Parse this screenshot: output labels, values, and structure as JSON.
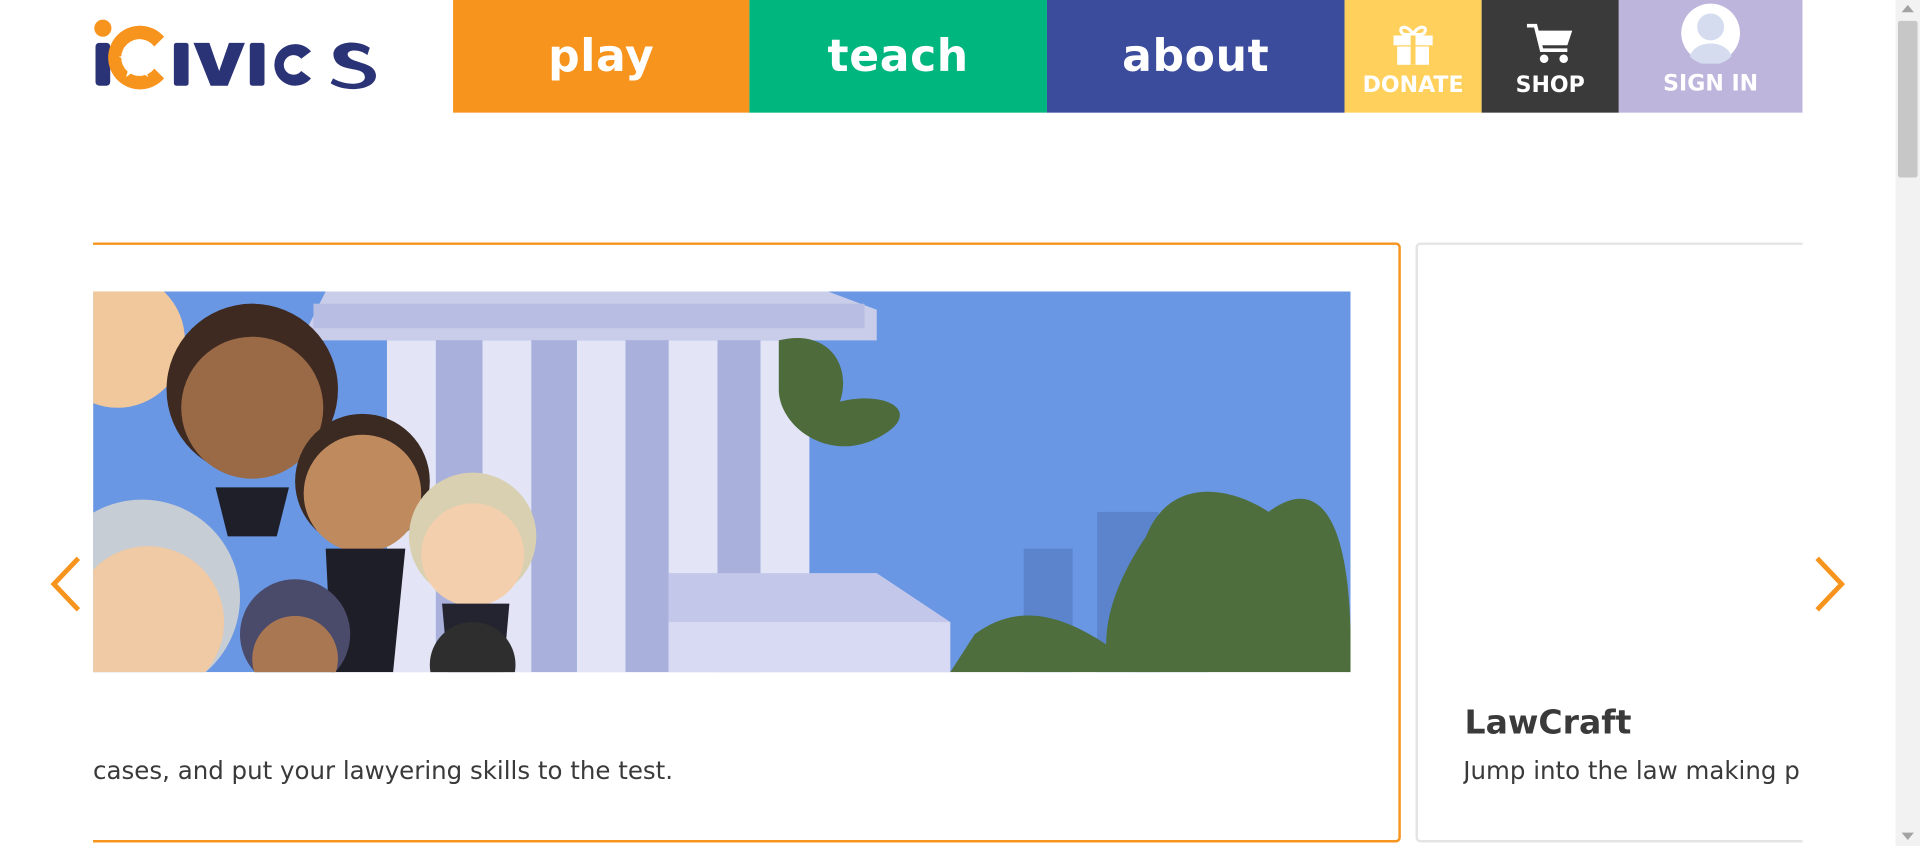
{
  "brand": {
    "name": "iCivics",
    "logo_color": "#2b3377",
    "accent": "#f7941d"
  },
  "nav": {
    "play": {
      "label": "play",
      "color": "#f7941d"
    },
    "teach": {
      "label": "teach",
      "color": "#00b67f"
    },
    "about": {
      "label": "about",
      "color": "#3a4c9b"
    }
  },
  "utility": {
    "donate": {
      "label": "DONATE",
      "icon": "gift-icon",
      "color": "#ffd15c"
    },
    "shop": {
      "label": "SHOP",
      "icon": "cart-icon",
      "color": "#3a3a3a"
    },
    "signin": {
      "label": "SIGN IN",
      "icon": "avatar-icon",
      "color": "#bdb5dc"
    }
  },
  "carousel": {
    "active_card": {
      "image": "supreme-court-justices-illustration",
      "description": "cases, and put your lawyering skills to the test."
    },
    "next_card": {
      "title": "LawCraft",
      "description": "Jump into the law making p"
    },
    "prev_icon": "chevron-left-icon",
    "next_icon": "chevron-right-icon"
  }
}
